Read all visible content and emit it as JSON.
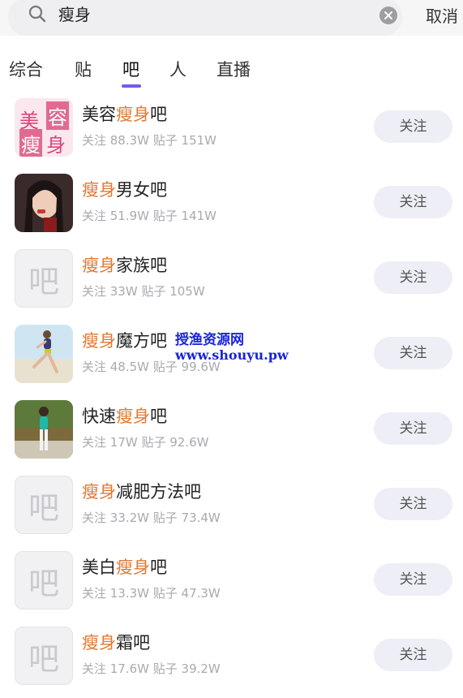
{
  "search": {
    "query": "瘦身",
    "cancel_label": "取消"
  },
  "tabs": [
    {
      "label": "综合"
    },
    {
      "label": "贴"
    },
    {
      "label": "吧"
    },
    {
      "label": "人"
    },
    {
      "label": "直播"
    }
  ],
  "active_tab": "吧",
  "accent_color": "#6f5cf2",
  "highlight_color": "#e07a35",
  "default_avatar_glyph": "吧",
  "results": [
    {
      "pre": "美容",
      "hl": "瘦身",
      "post": "吧",
      "meta": "关注 88.3W 贴子 151W",
      "follow": "关注",
      "avatar_text": [
        "美",
        "容",
        "瘦",
        "身"
      ]
    },
    {
      "pre": "",
      "hl": "瘦身",
      "post": "男女吧",
      "meta": "关注 51.9W 贴子 141W",
      "follow": "关注"
    },
    {
      "pre": "",
      "hl": "瘦身",
      "post": "家族吧",
      "meta": "关注 33W 贴子 105W",
      "follow": "关注"
    },
    {
      "pre": "",
      "hl": "瘦身",
      "post": "魔方吧",
      "meta": "关注 48.5W 贴子 99.6W",
      "follow": "关注"
    },
    {
      "pre": "快速",
      "hl": "瘦身",
      "post": "吧",
      "meta": "关注 17W 贴子 92.6W",
      "follow": "关注"
    },
    {
      "pre": "",
      "hl": "瘦身",
      "post": "减肥方法吧",
      "meta": "关注 33.2W 贴子 73.4W",
      "follow": "关注"
    },
    {
      "pre": "美白",
      "hl": "瘦身",
      "post": "吧",
      "meta": "关注 13.3W 贴子 47.3W",
      "follow": "关注"
    },
    {
      "pre": "",
      "hl": "瘦身",
      "post": "霜吧",
      "meta": "关注 17.6W 贴子 39.2W",
      "follow": "关注"
    }
  ],
  "watermark": {
    "line1": "授渔资源网",
    "line2": "www.shouyu.pw"
  }
}
